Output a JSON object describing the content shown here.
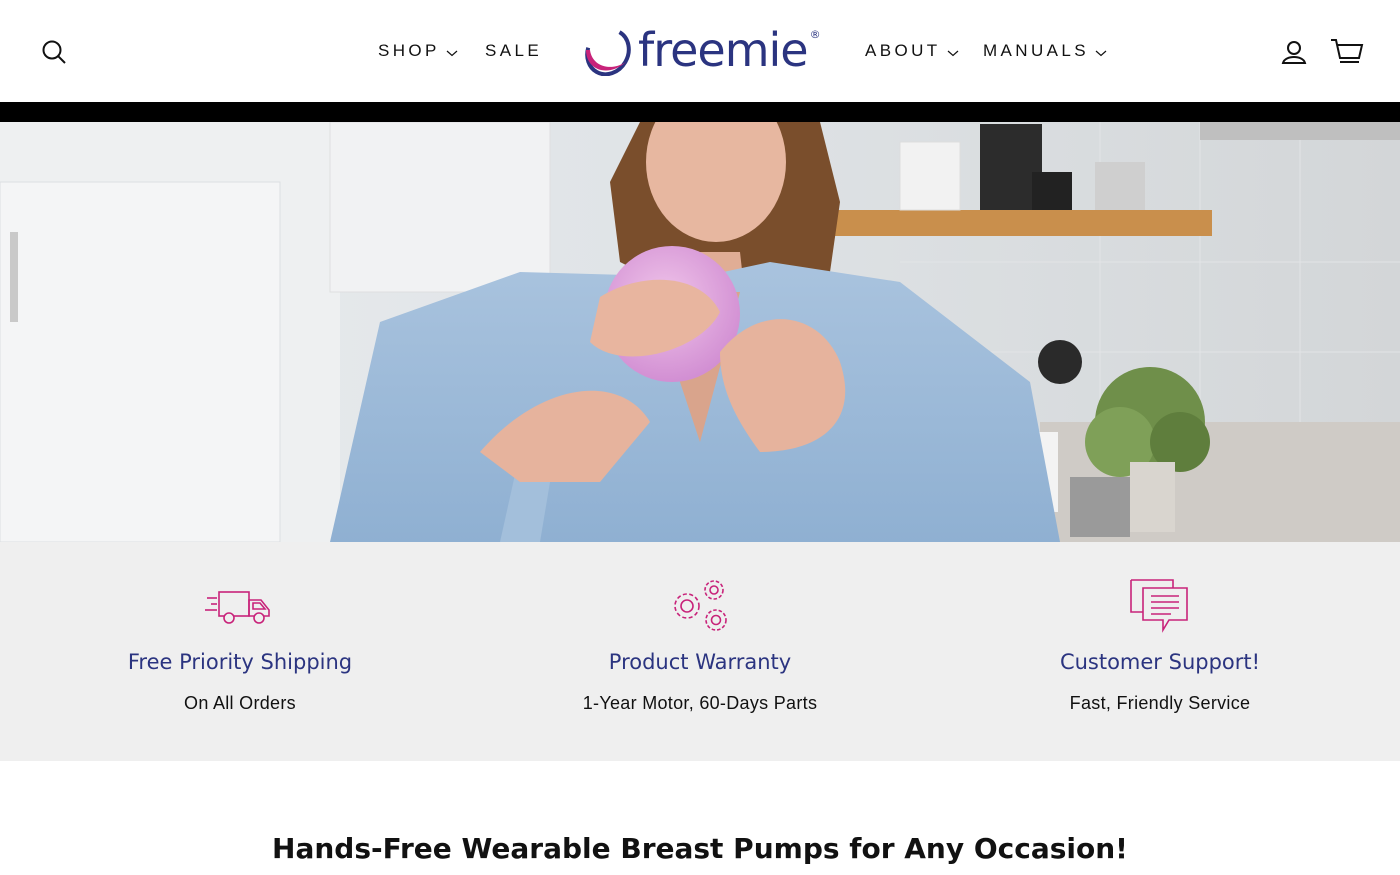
{
  "header": {
    "nav_left": [
      {
        "label": "SHOP",
        "has_dropdown": true
      },
      {
        "label": "SALE",
        "has_dropdown": false
      }
    ],
    "logo_text": "freemie",
    "logo_reg": "®",
    "nav_right": [
      {
        "label": "ABOUT",
        "has_dropdown": true
      },
      {
        "label": "MANUALS",
        "has_dropdown": true
      }
    ],
    "icons": [
      "search-icon",
      "account-icon",
      "cart-icon"
    ]
  },
  "hero": {
    "slides_count": 3,
    "active_slide": 2
  },
  "features": [
    {
      "icon": "truck-icon",
      "title": "Free Priority Shipping",
      "subtitle": "On All Orders"
    },
    {
      "icon": "gears-icon",
      "title": "Product Warranty",
      "subtitle": "1-Year Motor, 60-Days Parts"
    },
    {
      "icon": "chat-icon",
      "title": "Customer Support!",
      "subtitle": "Fast, Friendly Service"
    }
  ],
  "section_heading": "Hands-Free Wearable Breast Pumps for Any Occasion!",
  "colors": {
    "brand_navy": "#2b3480",
    "brand_magenta": "#c8237a",
    "feature_bg": "#efefef"
  }
}
